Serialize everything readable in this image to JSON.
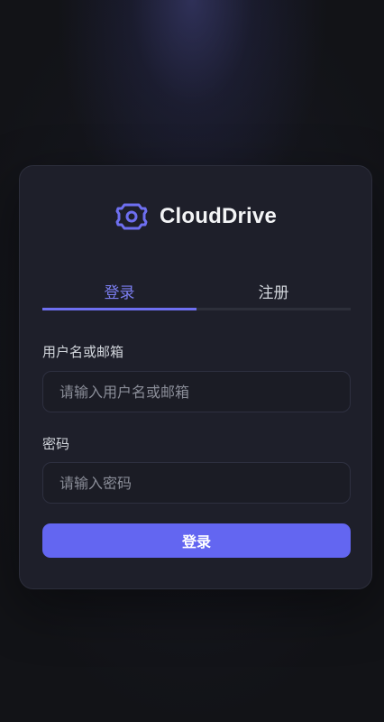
{
  "app": {
    "name": "CloudDrive",
    "logo_icon": "cloud-gear-logo",
    "accent_color": "#6366f1"
  },
  "tabs": [
    {
      "label": "登录",
      "active": true
    },
    {
      "label": "注册",
      "active": false
    }
  ],
  "form": {
    "username": {
      "label": "用户名或邮箱",
      "placeholder": "请输入用户名或邮箱",
      "value": ""
    },
    "password": {
      "label": "密码",
      "placeholder": "请输入密码",
      "value": ""
    },
    "submit_label": "登录"
  }
}
